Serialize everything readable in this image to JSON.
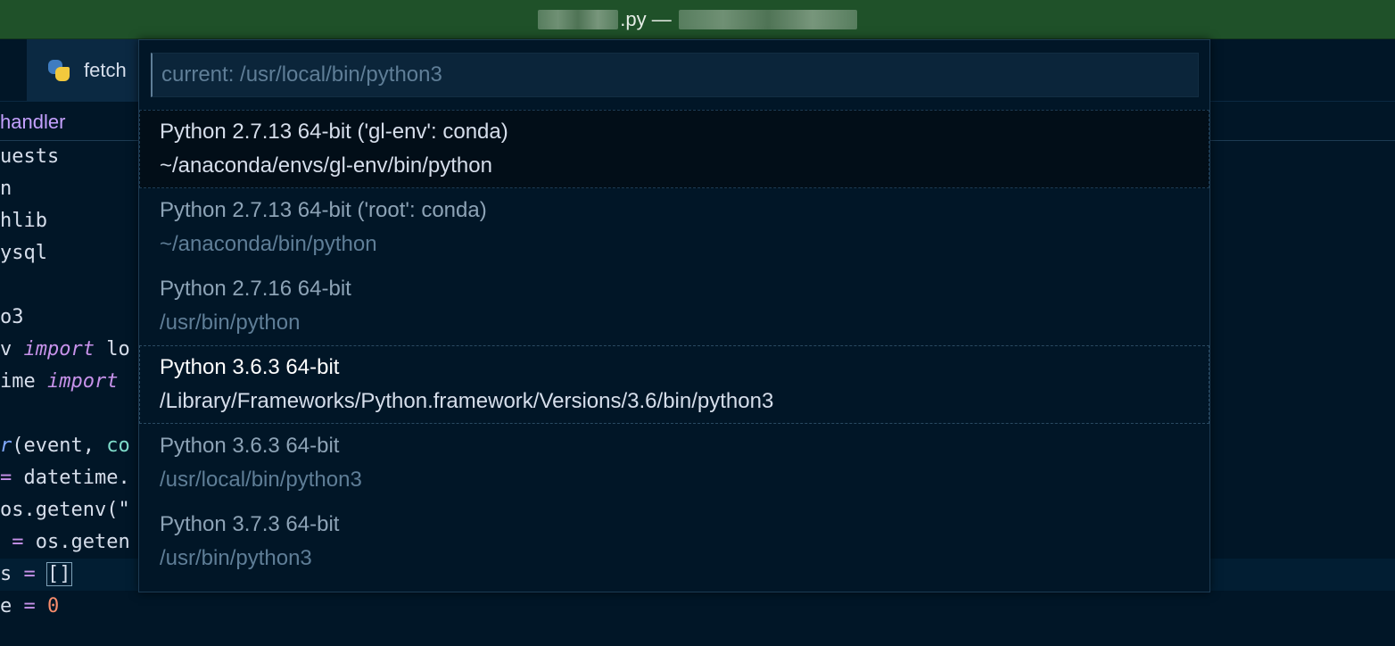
{
  "window": {
    "title": ".py —"
  },
  "tab": {
    "label": "fetch"
  },
  "breadcrumb": {
    "text": "handler"
  },
  "code_lines": [
    "uests",
    "n",
    "hlib",
    "ysql",
    "",
    "o3",
    "v ",
    "ime ",
    "",
    "",
    "",
    "os.getenv(\"",
    "",
    "",
    ""
  ],
  "code": {
    "l7_kw": "import",
    "l7_rest": " lo",
    "l8_kw": "import",
    "l10_fn": "r",
    "l10_a": "(",
    "l10_p1": "event",
    "l10_b": ", ",
    "l10_p2": "co",
    "l11_op": "=",
    "l11_rest": " datetime.",
    "l13_op": "=",
    "l13_rest": " os.geten",
    "l14_pre": "s ",
    "l14_op": "=",
    "l14_br": "[]",
    "l15_pre": "e ",
    "l15_op": "=",
    "l15_num": "0"
  },
  "picker": {
    "placeholder": "current: /usr/local/bin/python3",
    "items": [
      {
        "label": "Python 2.7.13 64-bit ('gl-env': conda)",
        "desc": "~/anaconda/envs/gl-env/bin/python"
      },
      {
        "label": "Python 2.7.13 64-bit ('root': conda)",
        "desc": "~/anaconda/bin/python"
      },
      {
        "label": "Python 2.7.16 64-bit",
        "desc": "/usr/bin/python"
      },
      {
        "label": "Python 3.6.3 64-bit",
        "desc": "/Library/Frameworks/Python.framework/Versions/3.6/bin/python3"
      },
      {
        "label": "Python 3.6.3 64-bit",
        "desc": "/usr/local/bin/python3"
      },
      {
        "label": "Python 3.7.3 64-bit",
        "desc": "/usr/bin/python3"
      }
    ]
  },
  "colors": {
    "titlebar": "#1f5129",
    "background": "#011627",
    "accent": "#c792ea"
  }
}
